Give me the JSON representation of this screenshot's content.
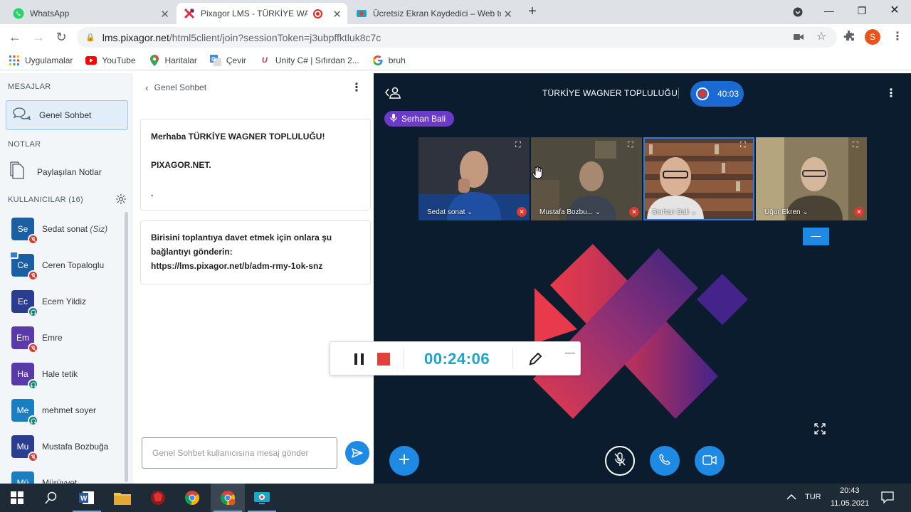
{
  "browser": {
    "tabs": [
      {
        "title": "WhatsApp",
        "icon": "whatsapp-icon"
      },
      {
        "title": "Pixagor LMS - TÜRKİYE WAG",
        "icon": "pixagor-icon",
        "active": true
      },
      {
        "title": "Ücretsiz Ekran Kaydedici – Web tc",
        "icon": "screen-recorder-icon"
      }
    ],
    "address_host": "lms.pixagor.net",
    "address_path": "/html5client/join?sessionToken=j3ubpffktluk8c7c",
    "profile_initial": "S",
    "bookmarks": [
      "Uygulamalar",
      "YouTube",
      "Haritalar",
      "Çevir",
      "Unity C# | Sıfırdan 2...",
      "bruh"
    ]
  },
  "sidebar": {
    "messages_title": "MESAJLAR",
    "public_chat": "Genel Sohbet",
    "notes_title": "NOTLAR",
    "shared_notes": "Paylaşılan Notlar",
    "users_title": "KULLANICILAR (16)",
    "users": [
      {
        "initials": "Se",
        "name": "Sedat sonat",
        "suffix": "(Siz)",
        "color": "#1a5fa3",
        "badge": "muted"
      },
      {
        "initials": "Ce",
        "name": "Ceren Topaloglu",
        "color": "#1a5fa3",
        "badge": "muted",
        "presenter": true
      },
      {
        "initials": "Ec",
        "name": "Ecem Yildiz",
        "color": "#2b3d8f",
        "badge": "listen"
      },
      {
        "initials": "Em",
        "name": "Emre",
        "color": "#5a3aa8",
        "badge": "muted"
      },
      {
        "initials": "Ha",
        "name": "Hale tetik",
        "color": "#5a3aa8",
        "badge": "listen"
      },
      {
        "initials": "Me",
        "name": "mehmet soyer",
        "color": "#1a7ec0",
        "badge": "listen"
      },
      {
        "initials": "Mu",
        "name": "Mustafa Bozbuğa",
        "color": "#2b3d8f",
        "badge": "muted"
      },
      {
        "initials": "Mü",
        "name": "Mürüvvet",
        "color": "#1a7ec0",
        "badge": "none"
      }
    ]
  },
  "chat": {
    "header": "Genel Sohbet",
    "welcome_line1": "Merhaba TÜRKİYE WAGNER TOPLULUĞU!",
    "welcome_line2": "PIXAGOR.NET.",
    "welcome_line3": ".",
    "invite_line1": "Birisini toplantıya davet etmek için onlara şu",
    "invite_line2": "bağlantıyı gönderin:",
    "invite_link": "https://lms.pixagor.net/b/adm-rmy-1ok-snz",
    "input_placeholder": "Genel Sohbet kullanıcısına mesaj gönder"
  },
  "meeting": {
    "title": "TÜRKİYE WAGNER TOPLULUĞU",
    "recording_time": "40:03",
    "talking": "Serhan Bali",
    "tiles": [
      {
        "name": "Sedat sonat"
      },
      {
        "name": "Mustafa Bozbu..."
      },
      {
        "name": "Serhan Bali",
        "active": true
      },
      {
        "name": "Uğur Ekren"
      }
    ]
  },
  "recorder": {
    "time": "00:24:06"
  },
  "taskbar": {
    "lang": "TUR",
    "time": "20:43",
    "date": "11.05.2021"
  },
  "colors": {
    "accent": "#1f8ae4",
    "video_bg": "#0b1c2f",
    "record_red": "#e0413a",
    "talking_purple": "#6b3ac8"
  }
}
